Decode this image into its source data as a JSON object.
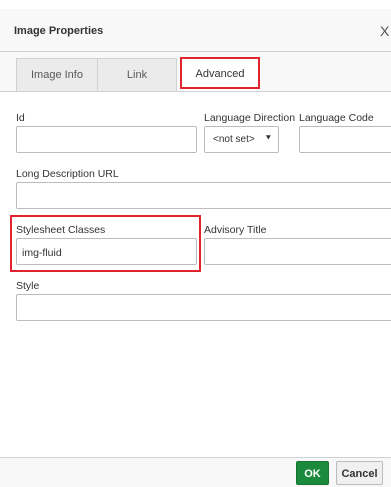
{
  "dialog": {
    "title": "Image Properties",
    "close_glyph": "X"
  },
  "tabs": [
    {
      "label": "Image Info",
      "active": false
    },
    {
      "label": "Link",
      "active": false
    },
    {
      "label": "Advanced",
      "active": true
    }
  ],
  "fields": {
    "id": {
      "label": "Id",
      "value": ""
    },
    "language_direction": {
      "label": "Language Direction",
      "selected": "<not set>"
    },
    "language_code": {
      "label": "Language Code",
      "value": ""
    },
    "long_description_url": {
      "label": "Long Description URL",
      "value": ""
    },
    "stylesheet_classes": {
      "label": "Stylesheet Classes",
      "value": "img-fluid"
    },
    "advisory_title": {
      "label": "Advisory Title",
      "value": ""
    },
    "style": {
      "label": "Style",
      "value": ""
    }
  },
  "buttons": {
    "ok": "OK",
    "cancel": "Cancel"
  },
  "colors": {
    "highlight": "#e0232e",
    "ok_button": "#1b8a3c"
  }
}
